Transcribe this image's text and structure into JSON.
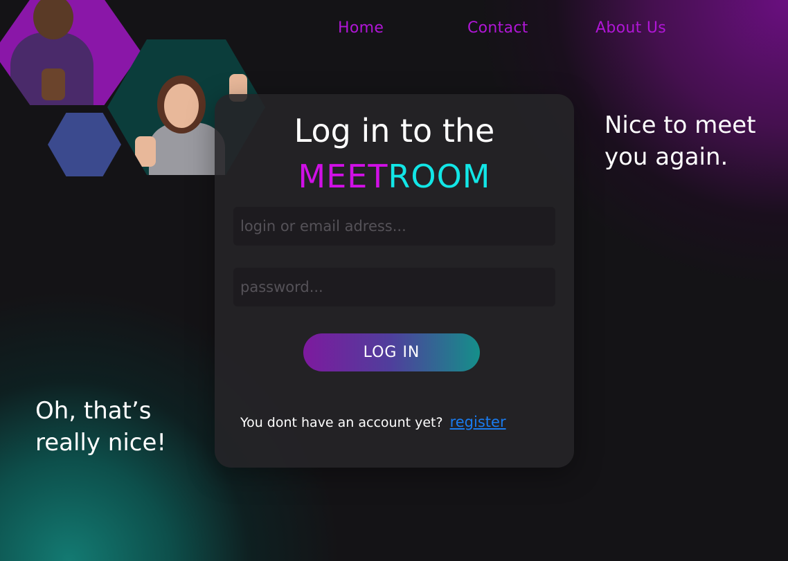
{
  "nav": {
    "items": [
      {
        "label": "Home"
      },
      {
        "label": "Contact"
      },
      {
        "label": "About Us"
      }
    ]
  },
  "taglines": {
    "right": "Nice to meet you again.",
    "left": "Oh, that’s really nice!"
  },
  "login": {
    "title": "Log in to the",
    "brand_part1": "MEET",
    "brand_part2": "ROOM",
    "login_placeholder": "login or email adress...",
    "password_placeholder": "password...",
    "button_label": "LOG IN",
    "register_prompt": "You dont have an account yet?",
    "register_link": "register"
  },
  "colors": {
    "accent_purple": "#b016d6",
    "brand_meet": "#d010e6",
    "brand_room": "#12e6e6",
    "link_blue": "#1a7cf0"
  }
}
